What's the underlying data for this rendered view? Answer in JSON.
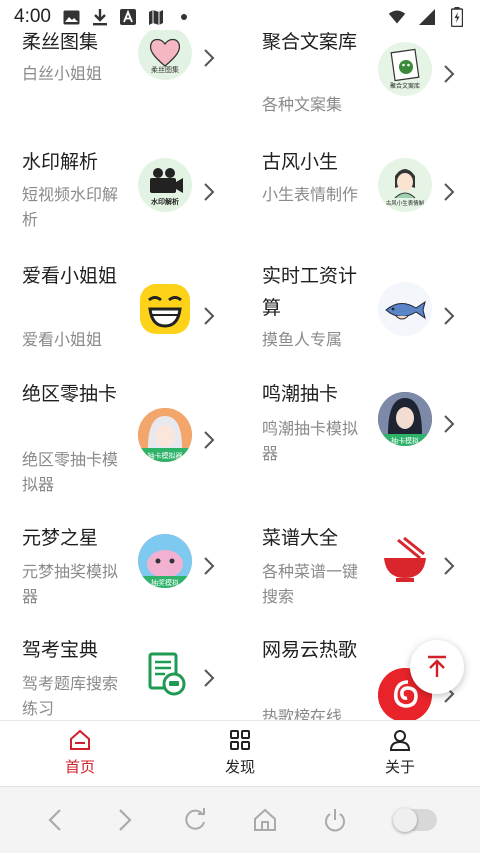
{
  "status_bar": {
    "time": "4:00"
  },
  "cards": [
    {
      "title": "柔丝图集",
      "desc": "白丝小姐姐",
      "icon": "heart-sticker-icon",
      "icon_caption": "柔丝图集"
    },
    {
      "title": "聚合文案库",
      "desc": "各种文案集",
      "icon": "notebook-frog-icon",
      "icon_caption": "聚合文案库"
    },
    {
      "title": "水印解析",
      "desc": "短视频水印解析",
      "icon": "camera-icon",
      "icon_caption": "水印解析"
    },
    {
      "title": "古风小生",
      "desc": "小生表情制作",
      "icon": "ancient-boy-icon",
      "icon_caption": "古风小生表情制"
    },
    {
      "title": "爱看小姐姐",
      "desc": "爱看小姐姐",
      "icon": "laughing-face-icon",
      "icon_caption": ""
    },
    {
      "title": "实时工资计算",
      "desc": "摸鱼人专属",
      "icon": "fish-icon",
      "icon_caption": ""
    },
    {
      "title": "绝区零抽卡",
      "desc": "绝区零抽卡模拟器",
      "icon": "anime-girl-icon",
      "icon_caption": "抽卡模拟器"
    },
    {
      "title": "鸣潮抽卡",
      "desc": "鸣潮抽卡模拟器",
      "icon": "anime-boy-icon",
      "icon_caption": "抽卡模拟"
    },
    {
      "title": "元梦之星",
      "desc": "元梦抽奖模拟器",
      "icon": "cute-pet-icon",
      "icon_caption": "抽奖模拟"
    },
    {
      "title": "菜谱大全",
      "desc": "各种菜谱一键搜索",
      "icon": "noodle-bowl-icon",
      "icon_caption": ""
    },
    {
      "title": "驾考宝典",
      "desc": "驾考题库搜索练习",
      "icon": "driving-doc-icon",
      "icon_caption": ""
    },
    {
      "title": "网易云热歌",
      "desc": "热歌榜在线",
      "icon": "netease-music-icon",
      "icon_caption": ""
    }
  ],
  "bottom_nav": [
    {
      "label": "首页",
      "icon": "home-icon",
      "active": true
    },
    {
      "label": "发现",
      "icon": "grid-icon",
      "active": false
    },
    {
      "label": "关于",
      "icon": "user-icon",
      "active": false
    }
  ],
  "colors": {
    "accent": "#d0202a",
    "muted_text": "#8a8a8a"
  }
}
